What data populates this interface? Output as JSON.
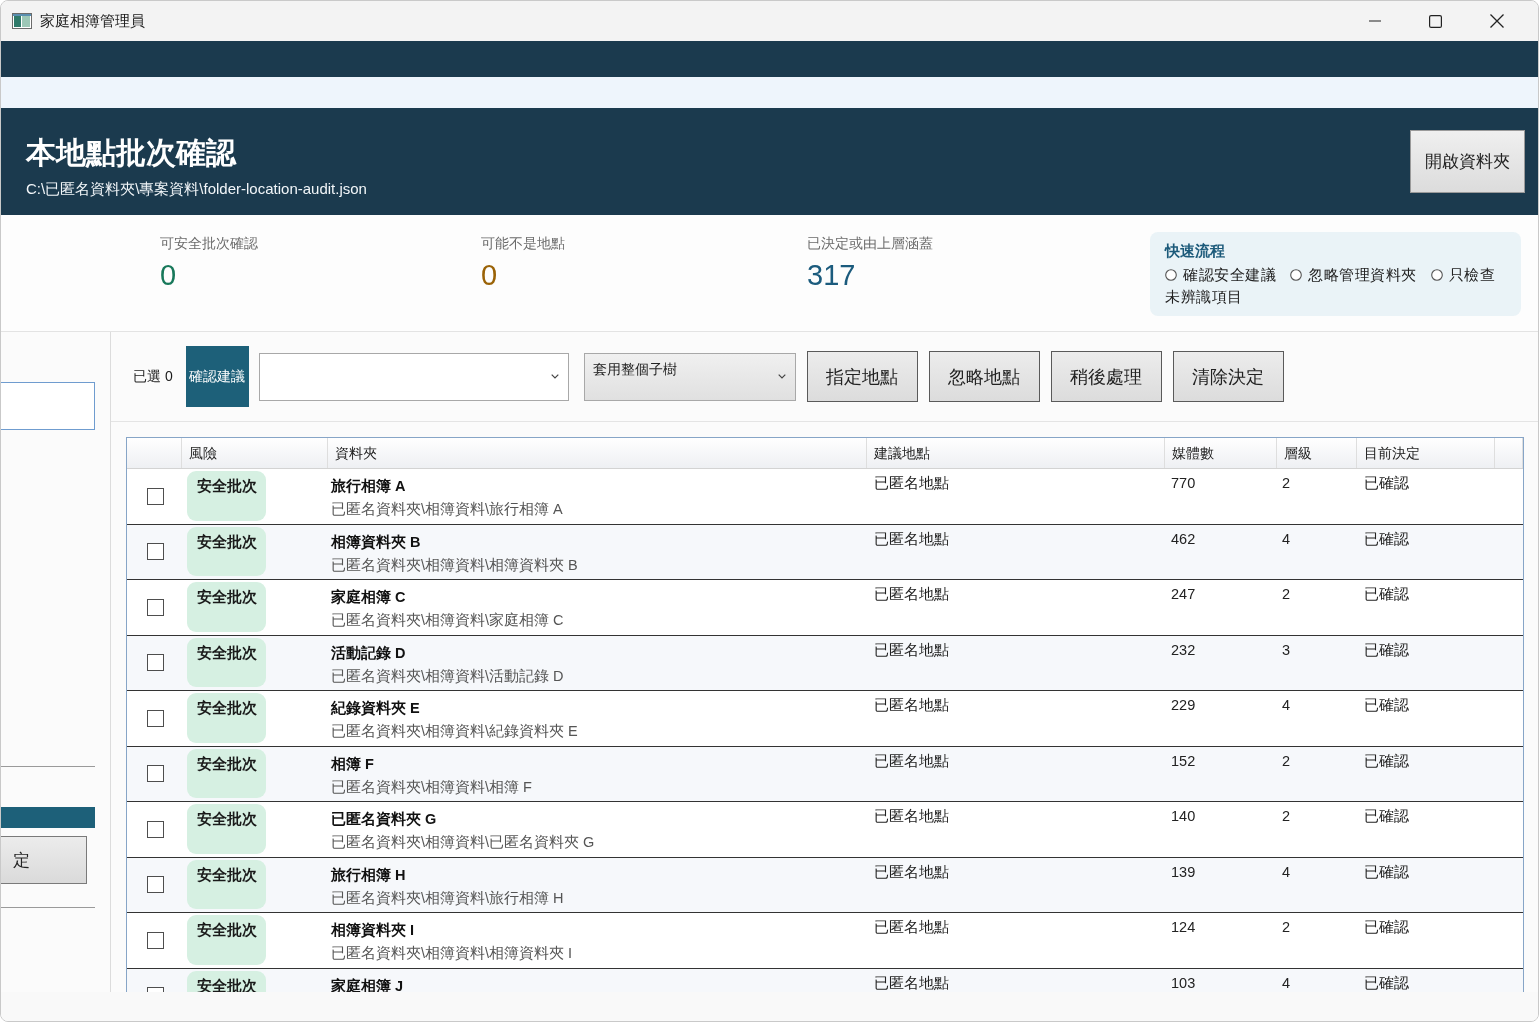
{
  "window": {
    "title": "家庭相簿管理員"
  },
  "header": {
    "title": "本地點批次確認",
    "path": "C:\\已匿名資料夾\\專案資料\\folder-location-audit.json",
    "open_button": "開啟資料夾"
  },
  "stats": [
    {
      "label": "可安全批次確認",
      "value": "0",
      "color": "#17785a"
    },
    {
      "label": "可能不是地點",
      "value": "0",
      "color": "#9a6206"
    },
    {
      "label": "已決定或由上層涵蓋",
      "value": "317",
      "color": "#1b5b7d"
    }
  ],
  "quick_flow": {
    "title": "快速流程",
    "options": [
      {
        "label": "確認安全建議",
        "selected": false
      },
      {
        "label": "忽略管理資料夾",
        "selected": false
      },
      {
        "label": "只檢查未辨識項目",
        "selected": false
      }
    ]
  },
  "side_panel": {
    "button": "定"
  },
  "toolbar": {
    "selected_count": "已選 0",
    "confirm_button": "確認建議",
    "scope_select": "套用整個子樹",
    "buttons": [
      "指定地點",
      "忽略地點",
      "稍後處理",
      "清除決定"
    ]
  },
  "table": {
    "columns": [
      "風險",
      "資料夾",
      "建議地點",
      "媒體數",
      "層級",
      "目前決定"
    ],
    "rows": [
      {
        "checked": false,
        "risk": {
          "label": "安全批次",
          "kind": "safe"
        },
        "name": "旅行相簿 A",
        "path": "已匿名資料夾\\相簿資料\\旅行相簿 A",
        "location": "已匿名地點",
        "media_count": "770",
        "layer": "2",
        "decision": "已確認"
      },
      {
        "checked": false,
        "risk": {
          "label": "安全批次",
          "kind": "safe"
        },
        "name": "相簿資料夾 B",
        "path": "已匿名資料夾\\相簿資料\\相簿資料夾 B",
        "location": "已匿名地點",
        "media_count": "462",
        "layer": "4",
        "decision": "已確認"
      },
      {
        "checked": false,
        "risk": {
          "label": "安全批次",
          "kind": "safe"
        },
        "name": "家庭相簿 C",
        "path": "已匿名資料夾\\相簿資料\\家庭相簿 C",
        "location": "已匿名地點",
        "media_count": "247",
        "layer": "2",
        "decision": "已確認"
      },
      {
        "checked": false,
        "risk": {
          "label": "安全批次",
          "kind": "safe"
        },
        "name": "活動記錄 D",
        "path": "已匿名資料夾\\相簿資料\\活動記錄 D",
        "location": "已匿名地點",
        "media_count": "232",
        "layer": "3",
        "decision": "已確認"
      },
      {
        "checked": false,
        "risk": {
          "label": "安全批次",
          "kind": "safe"
        },
        "name": "紀錄資料夾 E",
        "path": "已匿名資料夾\\相簿資料\\紀錄資料夾 E",
        "location": "已匿名地點",
        "media_count": "229",
        "layer": "4",
        "decision": "已確認"
      },
      {
        "checked": false,
        "risk": {
          "label": "安全批次",
          "kind": "safe"
        },
        "name": "相簿 F",
        "path": "已匿名資料夾\\相簿資料\\相簿 F",
        "location": "已匿名地點",
        "media_count": "152",
        "layer": "2",
        "decision": "已確認"
      },
      {
        "checked": false,
        "risk": {
          "label": "安全批次",
          "kind": "safe"
        },
        "name": "已匿名資料夾 G",
        "path": "已匿名資料夾\\相簿資料\\已匿名資料夾 G",
        "location": "已匿名地點",
        "media_count": "140",
        "layer": "2",
        "decision": "已確認"
      },
      {
        "checked": false,
        "risk": {
          "label": "安全批次",
          "kind": "safe"
        },
        "name": "旅行相簿 H",
        "path": "已匿名資料夾\\相簿資料\\旅行相簿 H",
        "location": "已匿名地點",
        "media_count": "139",
        "layer": "4",
        "decision": "已確認"
      },
      {
        "checked": false,
        "risk": {
          "label": "安全批次",
          "kind": "safe"
        },
        "name": "相簿資料夾 I",
        "path": "已匿名資料夾\\相簿資料\\相簿資料夾 I",
        "location": "已匿名地點",
        "media_count": "124",
        "layer": "2",
        "decision": "已確認"
      },
      {
        "checked": false,
        "risk": {
          "label": "安全批次",
          "kind": "safe"
        },
        "name": "家庭相簿 J",
        "location": "已匿名地點",
        "media_count": "103",
        "layer": "4",
        "decision": "已確認"
      }
    ]
  }
}
